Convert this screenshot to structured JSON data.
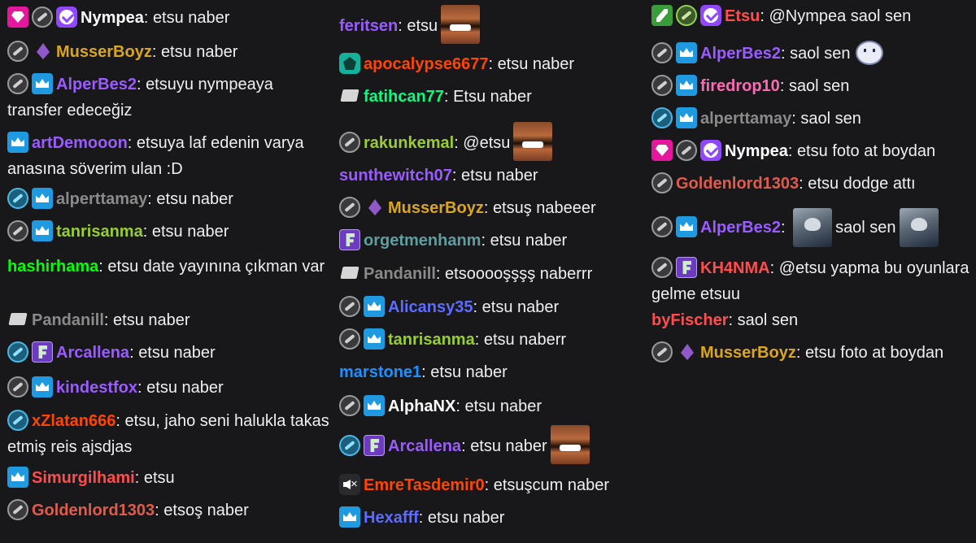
{
  "colors": {
    "background": "#18181b",
    "text": "#efeff1"
  },
  "columns": [
    {
      "messages": [
        {
          "badges": [
            "prime-gaming-icon",
            "gear-badge-icon",
            "verified-icon"
          ],
          "name": "Nympea",
          "color": "#ffffff",
          "text": "etsu naber"
        },
        {
          "badges": [
            "gear-badge-icon",
            "purple-gem-icon"
          ],
          "name": "MusserBoyz",
          "color": "#daa520",
          "text": "etsu naber"
        },
        {
          "badges": [
            "gear-badge-icon",
            "crown-icon"
          ],
          "name": "AlperBes2",
          "color": "#9a5bff",
          "text": "etsuyu nympeaya transfer edeceğiz"
        },
        {
          "badges": [
            "crown-icon"
          ],
          "name": "artDemooon",
          "color": "#9a5bff",
          "text": "etsuya laf edenin varya anasına söverim ulan :D"
        },
        {
          "badges": [
            "blue-gear-badge-icon",
            "crown-icon"
          ],
          "name": "alperttamay",
          "color": "#8a8a8a",
          "text": "etsu naber"
        },
        {
          "badges": [
            "gear-badge-icon",
            "crown-icon"
          ],
          "name": "tanrisanma",
          "color": "#9acd32",
          "text": "etsu naber"
        },
        {
          "badges": [],
          "name": "hashirhama",
          "color": "#00ff00",
          "text": "etsu date yayınına çıkman var"
        },
        {
          "badges": [
            "any-key-icon"
          ],
          "name": "Pandanill",
          "color": "#8a8a8a",
          "text": "etsu naber"
        },
        {
          "badges": [
            "blue-gear-badge-icon",
            "wizard-icon"
          ],
          "name": "Arcallena",
          "color": "#9a5bff",
          "text": "etsu naber"
        },
        {
          "badges": [
            "gear-badge-icon",
            "crown-icon"
          ],
          "name": "kindestfox",
          "color": "#9a5bff",
          "text": "etsu naber"
        },
        {
          "badges": [
            "blue-gear-badge-icon"
          ],
          "name": "xZlatan666",
          "color": "#ff4500",
          "text": "etsu, jaho seni halukla takas etmiş reis ajsdjas"
        },
        {
          "badges": [
            "crown-icon"
          ],
          "name": "Simurgilhami",
          "color": "#ff4d4d",
          "text": "etsu"
        },
        {
          "badges": [
            "gear-badge-icon"
          ],
          "name": "Goldenlord1303",
          "color": "#e05b4c",
          "text": "etsoş naber"
        }
      ]
    },
    {
      "messages": [
        {
          "badges": [],
          "name": "feritsen",
          "color": "#9a5bff",
          "text": "etsu",
          "emote": "laughing-face-emote"
        },
        {
          "badges": [
            "gift-box-icon"
          ],
          "name": "apocalypse6677",
          "color": "#ff4500",
          "text": "etsu naber"
        },
        {
          "badges": [
            "any-key-icon"
          ],
          "name": "fatihcan77",
          "color": "#00ff7f",
          "text": "Etsu naber"
        },
        {
          "badges": [
            "gear-badge-icon"
          ],
          "name": "rakunkemal",
          "color": "#9acd32",
          "text": "@etsu",
          "emote": "laughing-face-emote"
        },
        {
          "badges": [],
          "name": "sunthewitch07",
          "color": "#9a5bff",
          "text": "etsu naber"
        },
        {
          "badges": [
            "gear-badge-icon",
            "purple-gem-icon"
          ],
          "name": "MusserBoyz",
          "color": "#daa520",
          "text": "etsuş nabeeer"
        },
        {
          "badges": [
            "wizard-icon"
          ],
          "name": "orgetmenhanm",
          "color": "#5f9ea0",
          "text": "etsu naber"
        },
        {
          "badges": [
            "any-key-icon"
          ],
          "name": "Pandanill",
          "color": "#8a8a8a",
          "text": "etsooooşşşş naberrr"
        },
        {
          "badges": [
            "gear-badge-icon",
            "crown-icon"
          ],
          "name": "Alicansy35",
          "color": "#5d6cff",
          "text": "etsu naber"
        },
        {
          "badges": [
            "gear-badge-icon",
            "crown-icon"
          ],
          "name": "tanrisanma",
          "color": "#9acd32",
          "text": "etsu naberr"
        },
        {
          "badges": [],
          "name": "marstone1",
          "color": "#1e90ff",
          "text": "etsu naber"
        },
        {
          "badges": [
            "gear-badge-icon",
            "crown-icon"
          ],
          "name": "AlphaNX",
          "color": "#ffffff",
          "text": "etsu naber"
        },
        {
          "badges": [
            "blue-gear-badge-icon",
            "wizard-icon"
          ],
          "name": "Arcallena",
          "color": "#9a5bff",
          "text": "etsu naber",
          "emote": "laughing-face-emote"
        },
        {
          "badges": [
            "muted-speaker-icon"
          ],
          "name": "EmreTasdemir0",
          "color": "#ff4500",
          "text": "etsuşcum naber"
        },
        {
          "badges": [
            "crown-icon"
          ],
          "name": "Hexafff",
          "color": "#5d6cff",
          "text": "etsu naber"
        }
      ]
    },
    {
      "messages": [
        {
          "badges": [
            "sword-icon",
            "green-gear-badge-icon",
            "verified-icon"
          ],
          "name": "Etsu",
          "color": "#ff4d4d",
          "text": "@Nympea  saol sen"
        },
        {
          "badges": [
            "gear-badge-icon",
            "crown-icon"
          ],
          "name": "AlperBes2",
          "color": "#9a5bff",
          "text": "saol sen",
          "emote": "smiling-mask-emote"
        },
        {
          "badges": [
            "gear-badge-icon",
            "crown-icon"
          ],
          "name": "firedrop10",
          "color": "#ff69b4",
          "text": "saol sen"
        },
        {
          "badges": [
            "blue-gear-badge-icon",
            "crown-icon"
          ],
          "name": "alperttamay",
          "color": "#8a8a8a",
          "text": "saol sen"
        },
        {
          "badges": [
            "prime-gaming-icon",
            "gear-badge-icon",
            "verified-icon"
          ],
          "name": "Nympea",
          "color": "#ffffff",
          "text": "etsu foto at boydan"
        },
        {
          "badges": [
            "gear-badge-icon"
          ],
          "name": "Goldenlord1303",
          "color": "#e05b4c",
          "text": "etsu dodge attı"
        },
        {
          "badges": [
            "gear-badge-icon",
            "crown-icon"
          ],
          "name": "AlperBes2",
          "color": "#9a5bff",
          "text": "saol sen",
          "emote": "cat-photo-emote",
          "emote_before": true
        },
        {
          "badges": [
            "gear-badge-icon",
            "wizard-icon"
          ],
          "name": "KH4NMA",
          "color": "#ff4d4d",
          "text": "@etsu  yapma bu oyunlara gelme etsuu"
        },
        {
          "badges": [],
          "name": "byFischer",
          "color": "#ff4d4d",
          "text": "saol sen"
        },
        {
          "badges": [
            "gear-badge-icon",
            "purple-gem-icon"
          ],
          "name": "MusserBoyz",
          "color": "#daa520",
          "text": "etsu foto at boydan"
        }
      ]
    }
  ]
}
